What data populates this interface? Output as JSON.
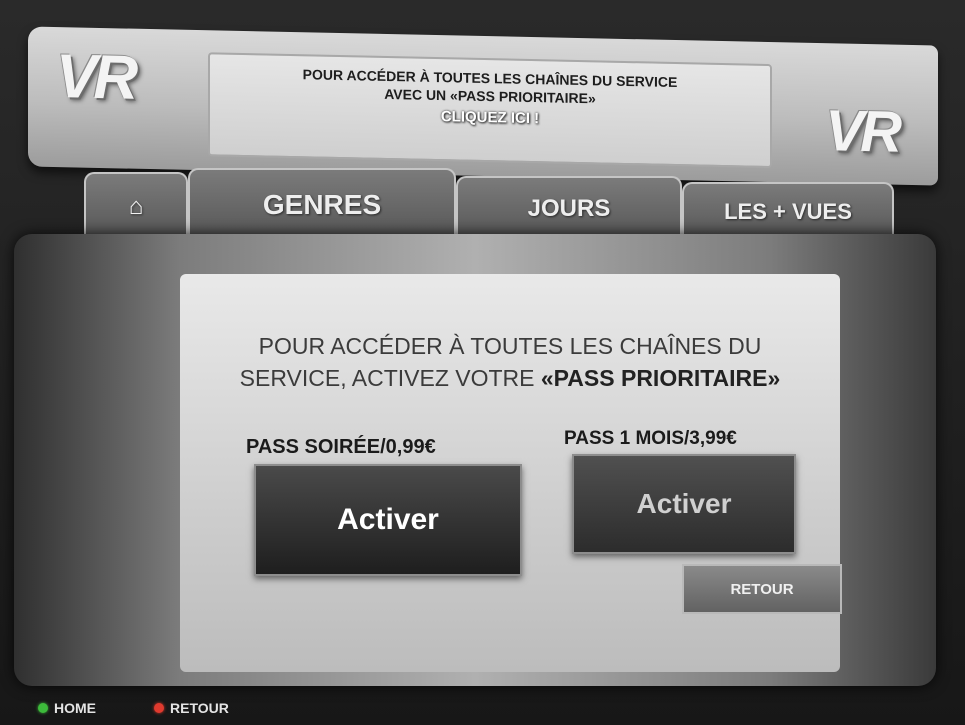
{
  "banner": {
    "logo_text": "VR",
    "promo_line1": "POUR ACCÉDER À TOUTES LES CHAÎNES DU SERVICE",
    "promo_line2": "AVEC UN «PASS PRIORITAIRE»",
    "promo_cta": "CLIQUEZ ICI !"
  },
  "tabs": [
    {
      "label": "⌂",
      "icon": "home-icon"
    },
    {
      "label": "GENRES"
    },
    {
      "label": "JOURS"
    },
    {
      "label": "LES + VUES"
    }
  ],
  "main": {
    "headline_line1": "POUR ACCÉDER À TOUTES LES CHAÎNES DU",
    "headline_line2_prefix": "SERVICE, ACTIVEZ VOTRE ",
    "headline_line2_bold": "«PASS PRIORITAIRE»",
    "pass_soiree_label": "PASS SOIRÉE/0,99€",
    "pass_mois_label": "PASS 1 MOIS/3,99€",
    "activate_label_1": "Activer",
    "activate_label_2": "Activer",
    "retour_button": "RETOUR"
  },
  "legend": {
    "home": "HOME",
    "retour": "RETOUR",
    "home_color": "#3dbb3b",
    "retour_color": "#e03a2e"
  }
}
